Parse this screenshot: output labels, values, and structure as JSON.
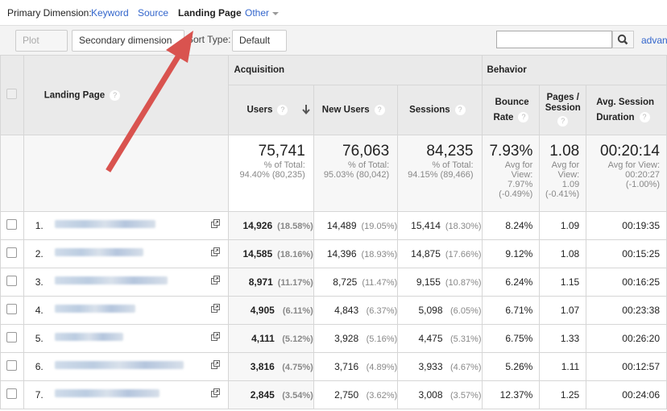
{
  "primary_dimension": {
    "label": "Primary Dimension:",
    "options": [
      {
        "label": "Keyword",
        "active": false
      },
      {
        "label": "Source",
        "active": false
      },
      {
        "label": "Landing Page",
        "active": true
      },
      {
        "label": "Other",
        "active": false
      }
    ]
  },
  "toolbar": {
    "plot_rows": "Plot Rows",
    "secondary_dimension": "Secondary dimension",
    "sort_type_label": "Sort Type:",
    "sort_type_value": "Default",
    "search_value": "",
    "advanced_link": "advanced"
  },
  "annotation": {
    "type": "arrow",
    "color": "#d9534f",
    "points_to": "Landing Page"
  },
  "table": {
    "groups": {
      "acquisition": "Acquisition",
      "behavior": "Behavior"
    },
    "headers": {
      "landing_page": "Landing Page",
      "users": "Users",
      "new_users": "New Users",
      "sessions": "Sessions",
      "bounce_rate_1": "Bounce",
      "bounce_rate_2": "Rate",
      "pages_session_1": "Pages /",
      "pages_session_2": "Session",
      "avg_duration_1": "Avg. Session",
      "avg_duration_2": "Duration"
    },
    "sort_icon": "arrow-down-icon",
    "totals": {
      "users": {
        "value": "75,741",
        "l1": "% of Total:",
        "l2": "94.40% (80,235)"
      },
      "new_users": {
        "value": "76,063",
        "l1": "% of Total:",
        "l2": "95.03% (80,042)"
      },
      "sessions": {
        "value": "84,235",
        "l1": "% of Total:",
        "l2": "94.15% (89,466)"
      },
      "bounce_rate": {
        "value": "7.93%",
        "l1": "Avg for",
        "l2": "View:",
        "l3": "7.97%",
        "l4": "(-0.49%)"
      },
      "pages_session": {
        "value": "1.08",
        "l1": "Avg for",
        "l2": "View:",
        "l3": "1.09",
        "l4": "(-0.41%)"
      },
      "avg_duration": {
        "value": "00:20:14",
        "l1": "Avg for View:",
        "l2": "00:20:27",
        "l3": "(-1.00%)"
      }
    },
    "rows": [
      {
        "rank": "1.",
        "users": "14,926",
        "users_pct": "(18.58%)",
        "new_users": "14,489",
        "new_users_pct": "(19.05%)",
        "sessions": "15,414",
        "sessions_pct": "(18.30%)",
        "bounce": "8.24%",
        "pps": "1.09",
        "dur": "00:19:35"
      },
      {
        "rank": "2.",
        "users": "14,585",
        "users_pct": "(18.16%)",
        "new_users": "14,396",
        "new_users_pct": "(18.93%)",
        "sessions": "14,875",
        "sessions_pct": "(17.66%)",
        "bounce": "9.12%",
        "pps": "1.08",
        "dur": "00:15:25"
      },
      {
        "rank": "3.",
        "users": "8,971",
        "users_pct": "(11.17%)",
        "new_users": "8,725",
        "new_users_pct": "(11.47%)",
        "sessions": "9,155",
        "sessions_pct": "(10.87%)",
        "bounce": "6.24%",
        "pps": "1.15",
        "dur": "00:16:25"
      },
      {
        "rank": "4.",
        "users": "4,905",
        "users_pct": "(6.11%)",
        "new_users": "4,843",
        "new_users_pct": "(6.37%)",
        "sessions": "5,098",
        "sessions_pct": "(6.05%)",
        "bounce": "6.71%",
        "pps": "1.07",
        "dur": "00:23:38"
      },
      {
        "rank": "5.",
        "users": "4,111",
        "users_pct": "(5.12%)",
        "new_users": "3,928",
        "new_users_pct": "(5.16%)",
        "sessions": "4,475",
        "sessions_pct": "(5.31%)",
        "bounce": "6.75%",
        "pps": "1.33",
        "dur": "00:26:20"
      },
      {
        "rank": "6.",
        "users": "3,816",
        "users_pct": "(4.75%)",
        "new_users": "3,716",
        "new_users_pct": "(4.89%)",
        "sessions": "3,933",
        "sessions_pct": "(4.67%)",
        "bounce": "5.26%",
        "pps": "1.11",
        "dur": "00:12:57"
      },
      {
        "rank": "7.",
        "users": "2,845",
        "users_pct": "(3.54%)",
        "new_users": "2,750",
        "new_users_pct": "(3.62%)",
        "sessions": "3,008",
        "sessions_pct": "(3.57%)",
        "bounce": "12.37%",
        "pps": "1.25",
        "dur": "00:24:06"
      }
    ]
  }
}
